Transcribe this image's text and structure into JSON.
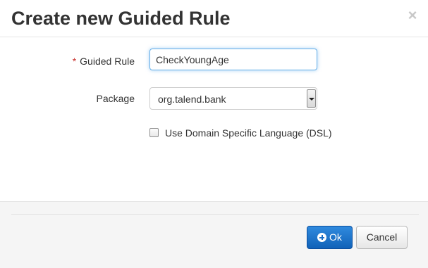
{
  "dialog": {
    "title": "Create new Guided Rule",
    "close_label": "×"
  },
  "form": {
    "rule_name": {
      "required_marker": "*",
      "label": "Guided Rule",
      "value": "CheckYoungAge"
    },
    "package": {
      "label": "Package",
      "selected": "org.talend.bank"
    },
    "dsl_checkbox": {
      "label": "Use Domain Specific Language (DSL)",
      "checked": false
    }
  },
  "footer": {
    "ok_label": "Ok",
    "cancel_label": "Cancel"
  },
  "colors": {
    "primary_button": "#1a6fc7",
    "required_marker": "#c9302c",
    "focus_border": "#66afe9"
  }
}
